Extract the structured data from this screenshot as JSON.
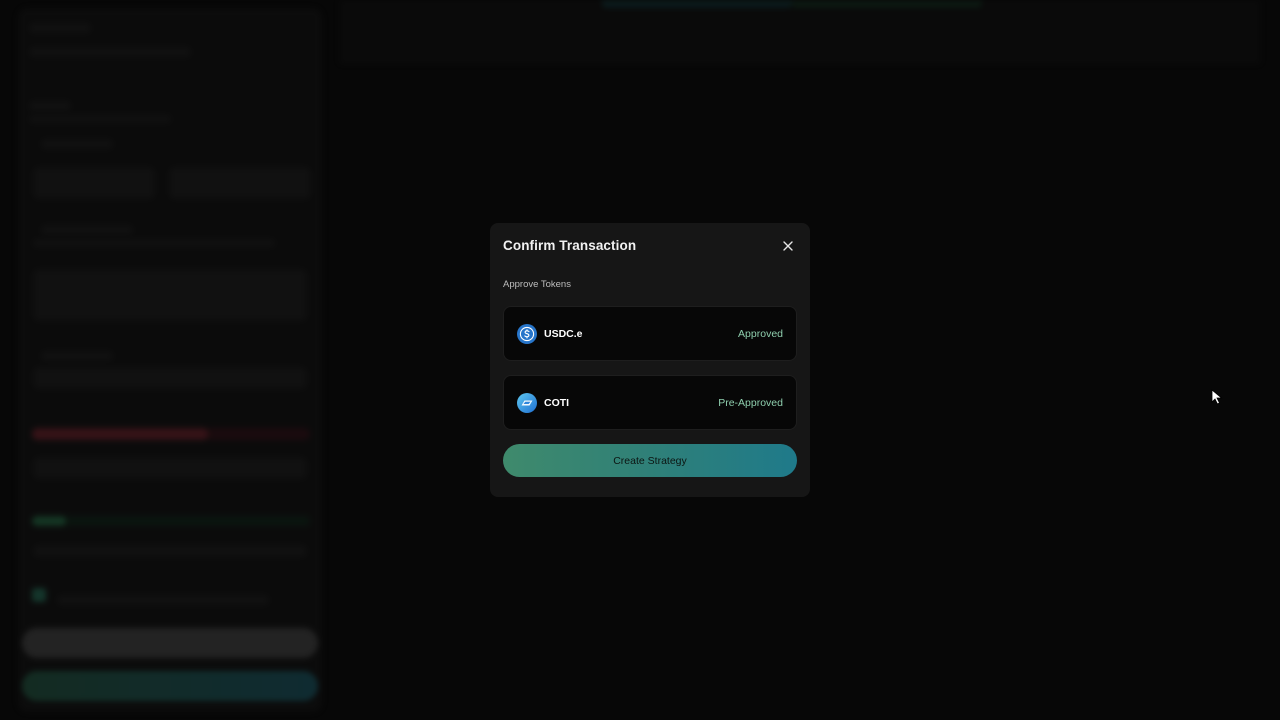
{
  "modal": {
    "title": "Confirm Transaction",
    "section_label": "Approve Tokens",
    "tokens": [
      {
        "name": "USDC.e",
        "status": "Approved",
        "icon": "usdc-icon"
      },
      {
        "name": "COTI",
        "status": "Pre-Approved",
        "icon": "coti-icon"
      }
    ],
    "primary_button": "Create Strategy",
    "close_icon": "close-icon"
  },
  "colors": {
    "modal_bg": "#161616",
    "card_bg": "#070707",
    "status_green": "#8fcfae",
    "button_gradient_start": "#3f8a6c",
    "button_gradient_end": "#1f7a8a",
    "usdc_blue": "#2775ca",
    "coti_blue": "#2d9cdb"
  }
}
